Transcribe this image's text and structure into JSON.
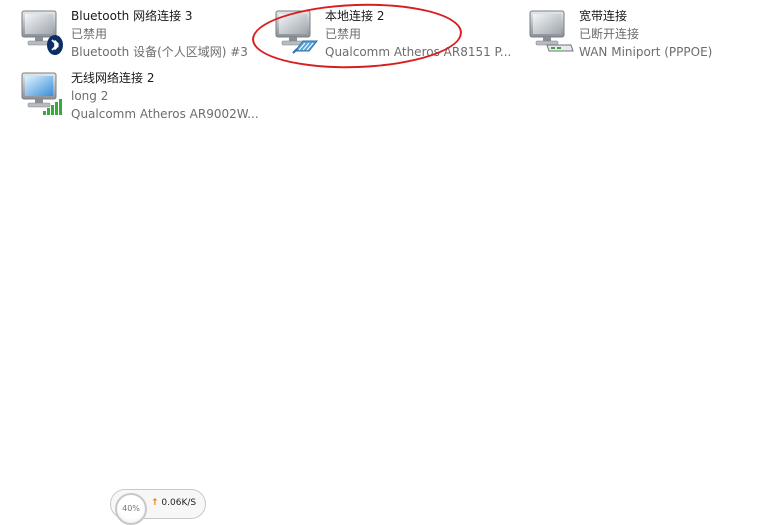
{
  "connections": [
    {
      "name": "Bluetooth 网络连接 3",
      "status": "已禁用",
      "device": "Bluetooth 设备(个人区域网) #3",
      "icon": "bluetooth-network-icon"
    },
    {
      "name": "本地连接 2",
      "status": "已禁用",
      "device": "Qualcomm Atheros AR8151 P...",
      "icon": "ethernet-network-icon"
    },
    {
      "name": "宽带连接",
      "status": "已断开连接",
      "device": "WAN Miniport (PPPOE)",
      "icon": "broadband-modem-icon"
    },
    {
      "name": "无线网络连接 2",
      "status": "long  2",
      "device": "Qualcomm Atheros AR9002W...",
      "icon": "wireless-signal-icon"
    }
  ],
  "net_widget": {
    "percent": "40%",
    "upload_speed": "0.06K/S"
  },
  "colors": {
    "annotation": "#d81e1e",
    "upload_arrow": "#f07a00",
    "signal_bars": "#3aa83a"
  }
}
